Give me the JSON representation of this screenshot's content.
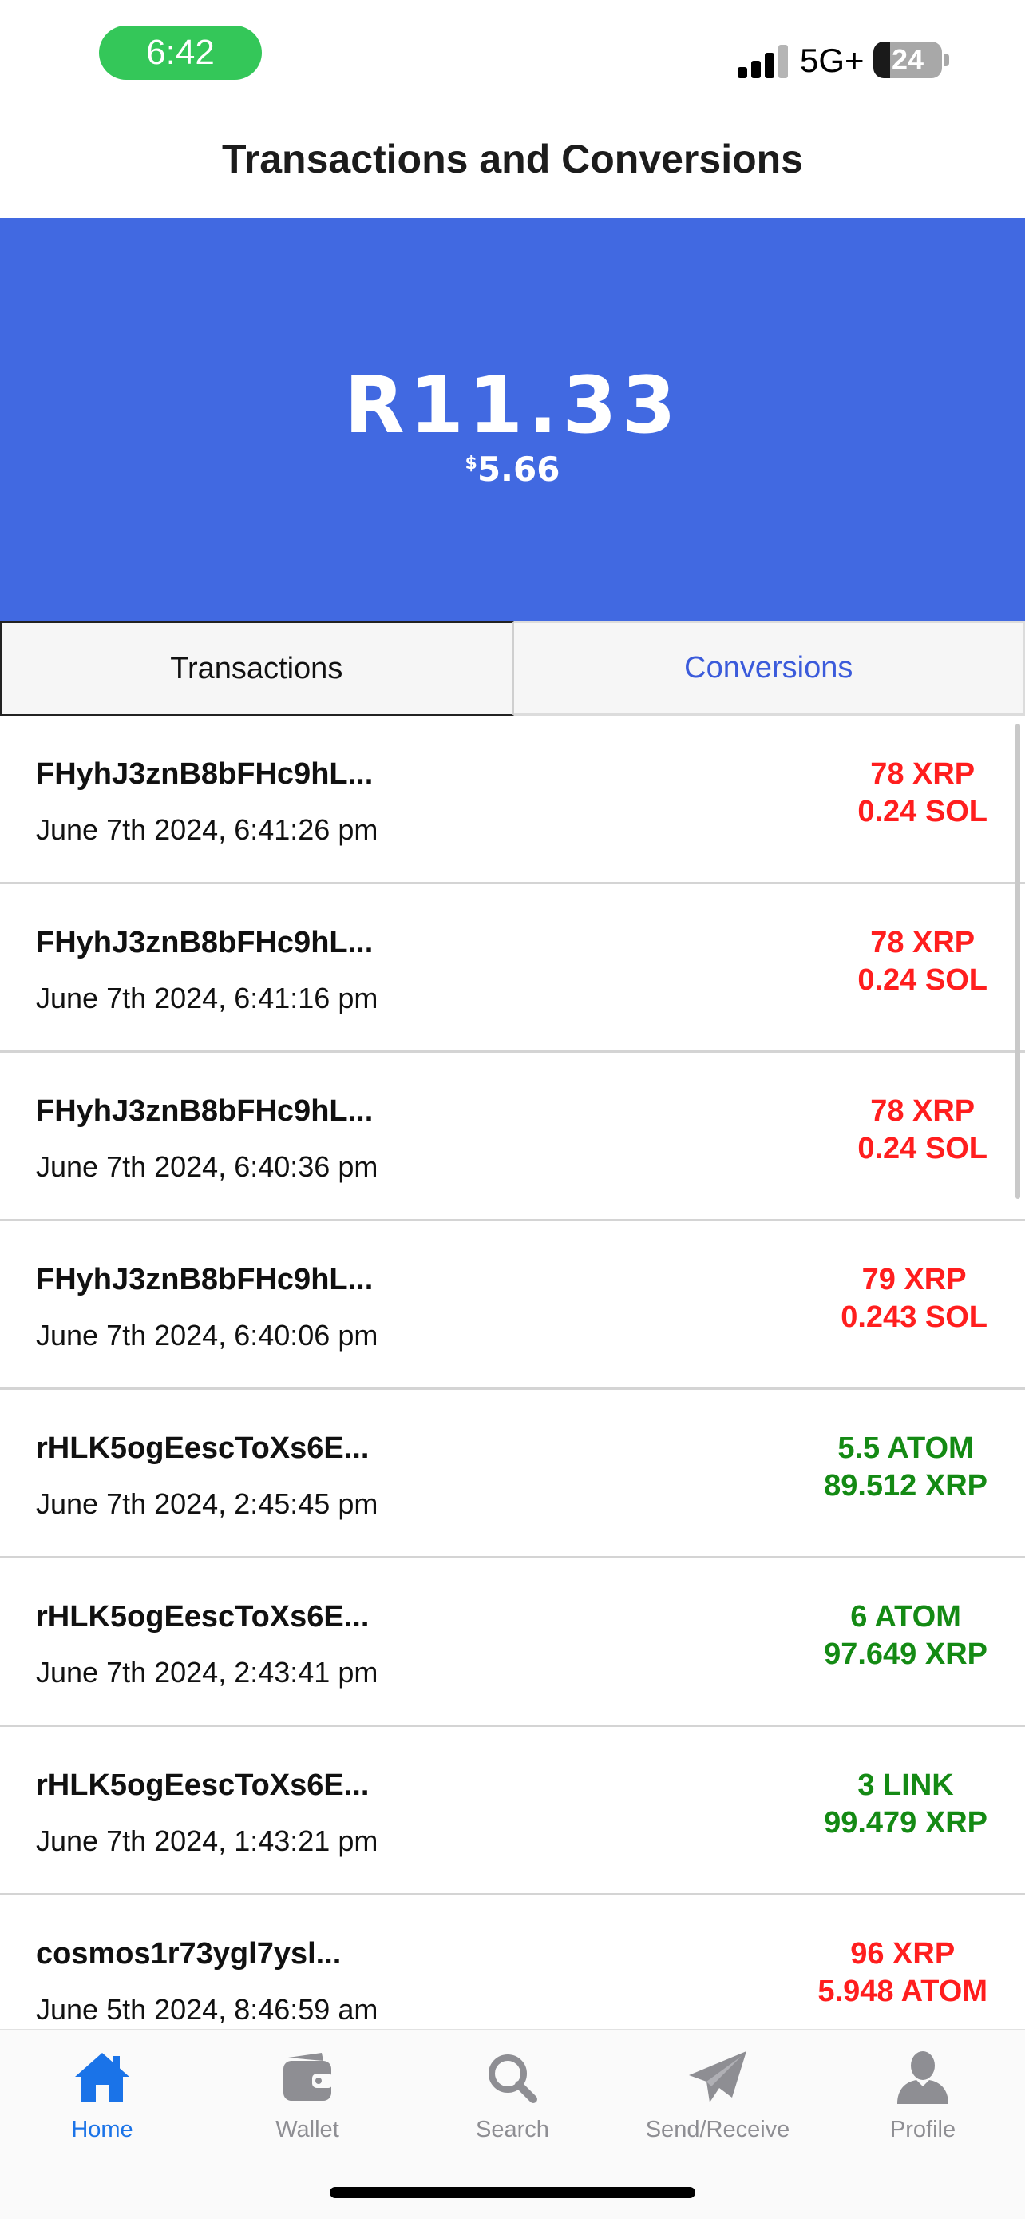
{
  "status_bar": {
    "time": "6:42",
    "network": "5G+",
    "battery": "24",
    "battery_level": 0.24,
    "time_pill_color": "#34c759"
  },
  "header": {
    "title": "Transactions and Conversions"
  },
  "balance": {
    "primary": "R11.33",
    "secondary_symbol": "$",
    "secondary_value": "5.66",
    "background_color": "#4169e1"
  },
  "tabs": [
    {
      "label": "Transactions",
      "active": false
    },
    {
      "label": "Conversions",
      "active": true
    }
  ],
  "transactions": [
    {
      "id": "FHyhJ3znB8bFHc9hL...",
      "date": "June 7th 2024, 6:41:26 pm",
      "line1": "78 XRP",
      "line2": "0.24 SOL",
      "tone": "red"
    },
    {
      "id": "FHyhJ3znB8bFHc9hL...",
      "date": "June 7th 2024, 6:41:16 pm",
      "line1": "78 XRP",
      "line2": "0.24 SOL",
      "tone": "red"
    },
    {
      "id": "FHyhJ3znB8bFHc9hL...",
      "date": "June 7th 2024, 6:40:36 pm",
      "line1": "78 XRP",
      "line2": "0.24 SOL",
      "tone": "red"
    },
    {
      "id": "FHyhJ3znB8bFHc9hL...",
      "date": "June 7th 2024, 6:40:06 pm",
      "line1": "79 XRP",
      "line2": "0.243 SOL",
      "tone": "red"
    },
    {
      "id": "rHLK5ogEescToXs6E...",
      "date": "June 7th 2024, 2:45:45 pm",
      "line1": "5.5 ATOM",
      "line2": "89.512 XRP",
      "tone": "green"
    },
    {
      "id": "rHLK5ogEescToXs6E...",
      "date": "June 7th 2024, 2:43:41 pm",
      "line1": "6 ATOM",
      "line2": "97.649 XRP",
      "tone": "green"
    },
    {
      "id": "rHLK5ogEescToXs6E...",
      "date": "June 7th 2024, 1:43:21 pm",
      "line1": "3 LINK",
      "line2": "99.479 XRP",
      "tone": "green"
    },
    {
      "id": "cosmos1r73ygl7ysl...",
      "date": "June 5th 2024, 8:46:59 am",
      "line1": "96 XRP",
      "line2": "5.948 ATOM",
      "tone": "red"
    }
  ],
  "nav": [
    {
      "label": "Home",
      "icon": "home-icon",
      "active": true
    },
    {
      "label": "Wallet",
      "icon": "wallet-icon",
      "active": false
    },
    {
      "label": "Search",
      "icon": "search-icon",
      "active": false
    },
    {
      "label": "Send/Receive",
      "icon": "send-icon",
      "active": false
    },
    {
      "label": "Profile",
      "icon": "profile-icon",
      "active": false
    }
  ],
  "colors": {
    "negative": "#ff1e1e",
    "positive": "#148a14",
    "active_nav": "#1a73e8",
    "inactive_nav": "#8e8e93",
    "active_tab_text": "#3b5bdb"
  }
}
